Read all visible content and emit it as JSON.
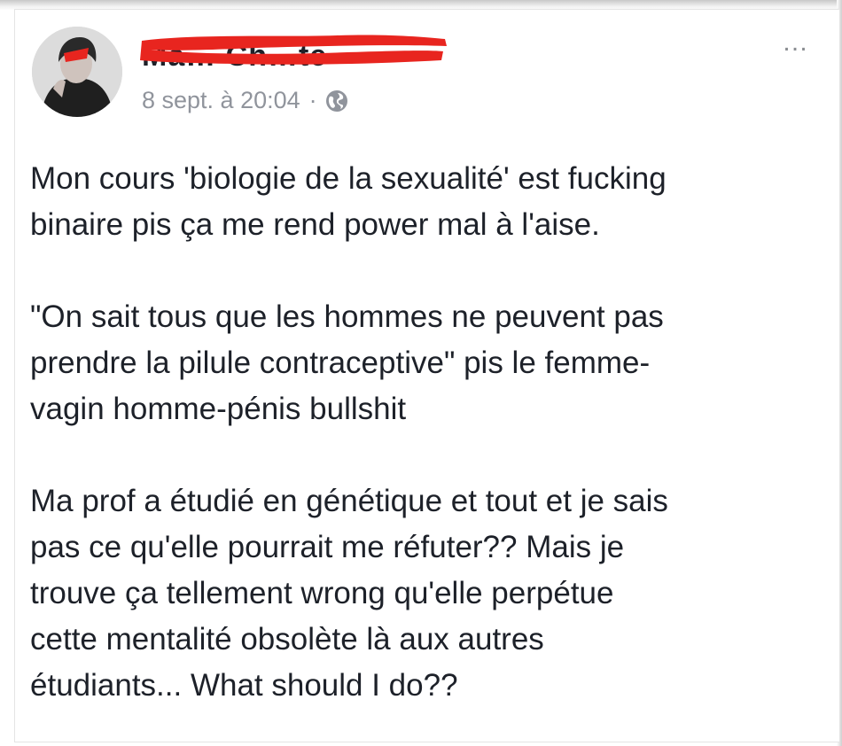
{
  "post": {
    "author_name": "Ma… Ch…te",
    "timestamp": "8 sept. à 20:04",
    "separator": "·",
    "privacy_icon": "globe-icon",
    "more_label": "…",
    "paragraphs": [
      "Mon cours 'biologie de la sexualité' est fucking\nbinaire pis ça me rend power mal à l'aise.",
      "\"On sait tous que les hommes ne peuvent pas\nprendre la pilule contraceptive\" pis le femme-\nvagin homme-pénis bullshit",
      "Ma prof a étudié en génétique et tout et je sais\npas ce qu'elle pourrait me réfuter?? Mais je\ntrouve ça tellement wrong qu'elle perpétue\ncette mentalité obsolète là aux autres\nétudiants... What should I do??"
    ]
  },
  "colors": {
    "redaction": "#e8251f",
    "text": "#1d2129",
    "meta": "#90949c"
  }
}
